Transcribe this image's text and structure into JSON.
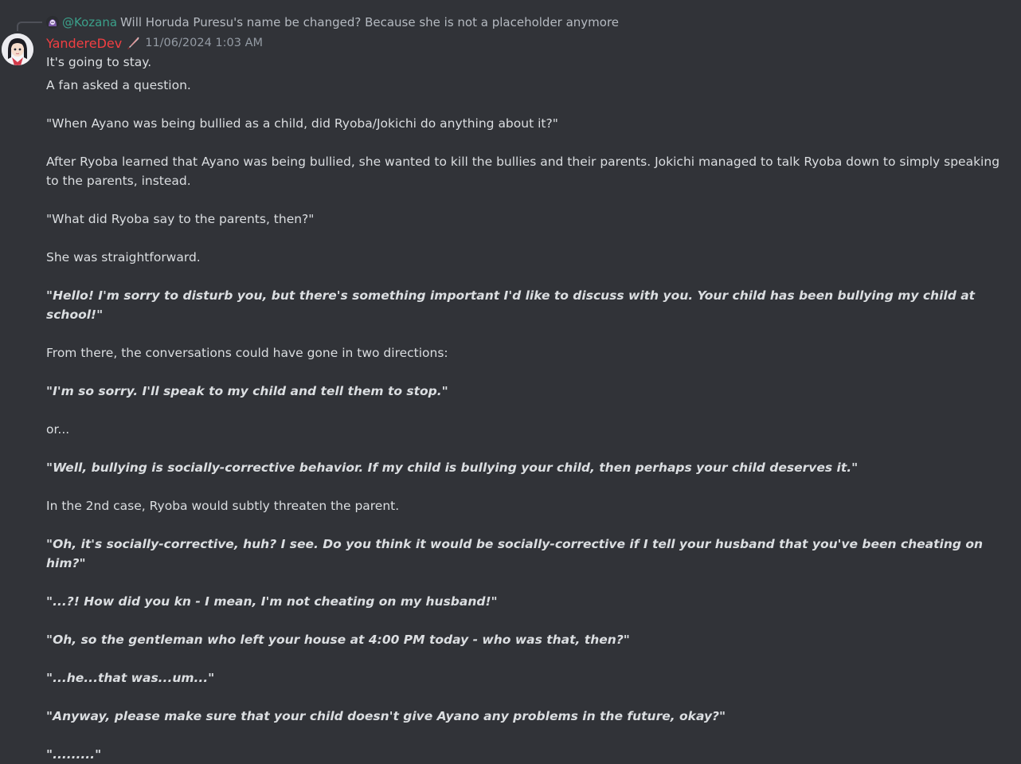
{
  "reply": {
    "author": "@Kozana",
    "text": "Will Horuda Puresu's name be changed? Because she is not a placeholder anymore"
  },
  "message": {
    "author": "YandereDev",
    "role_icon": "knife-icon",
    "timestamp": "11/06/2024 1:03 AM",
    "lines": [
      "It's going to stay.",
      "A fan asked a question.",
      "\"When Ayano was being bullied as a child, did Ryoba/Jokichi do anything about it?\"",
      "After Ryoba learned that Ayano was being bullied, she wanted to kill the bullies and their parents. Jokichi managed to talk Ryoba down to simply speaking to the parents, instead.",
      "\"What did Ryoba say to the parents, then?\"",
      "She was straightforward.",
      "\"Hello! I'm sorry to disturb you, but there's something important I'd like to discuss with you. Your child has been bullying my child at school!\"",
      "From there, the conversations could have gone in two directions:",
      "\"I'm so sorry. I'll speak to my child and tell them to stop.\"",
      "or...",
      "\"Well, bullying is socially-corrective behavior. If my child is bullying your child, then perhaps your child deserves it.\"",
      "In the 2nd case, Ryoba would subtly threaten the parent.",
      "\"Oh, it's socially-corrective, huh? I see. Do you think it would be socially-corrective if I tell your husband that you've been cheating on him?\"",
      "\"...?! How did you kn -  I mean, I'm not cheating on my husband!\"",
      "\"Oh, so the gentleman who left your house at 4:00 PM today - who was that, then?\"",
      "\"...he...that was...um...\"",
      "\"Anyway, please make sure that your child doesn't give Ayano any problems in the future, okay?\"",
      "\".........\""
    ]
  }
}
